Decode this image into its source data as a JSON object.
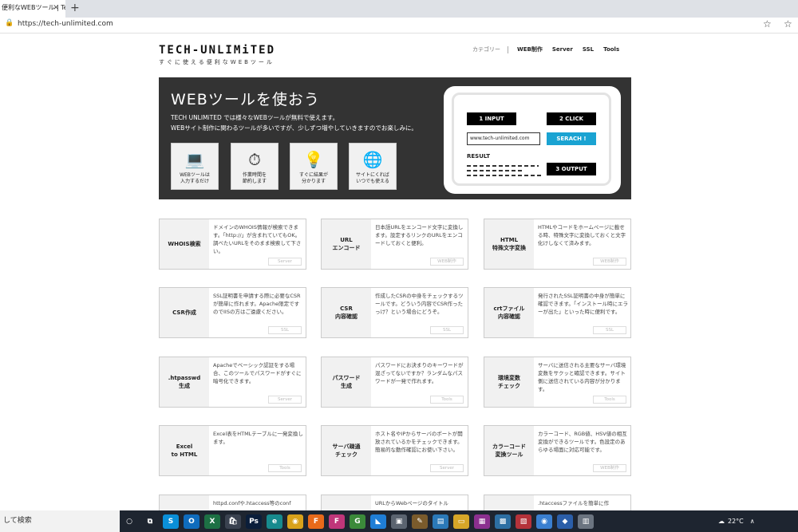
{
  "browser": {
    "tab_title": "便利なWEBツール | Tec",
    "tab_close": "×",
    "new_tab": "+",
    "url": "https://tech-unlimited.com",
    "icons": [
      "lock-icon",
      "favorites-add-icon",
      "favorites-icon"
    ]
  },
  "header": {
    "logo": "TECH-UNLIMiTED",
    "tagline": "すぐに使える便利なWEBツール",
    "nav_category": "カテゴリー",
    "nav": [
      "WEB制作",
      "Server",
      "SSL",
      "Tools"
    ]
  },
  "hero": {
    "title": "WEBツールを使おう",
    "line1": "TECH UNLIMiTED では様々なWEBツールが無料で使えます。",
    "line2": "WEBサイト制作に関わるツールが多いですが、少しずつ増やしていきますのでお楽しみに。",
    "features": [
      {
        "icon": "laptop-icon",
        "glyph": "💻",
        "label": "WEBツールは\n入力するだけ"
      },
      {
        "icon": "clock-money-icon",
        "glyph": "⏱",
        "label": "作業時間を\n節約します"
      },
      {
        "icon": "lightbulb-icon",
        "glyph": "💡",
        "label": "すぐに結果が\n分かります"
      },
      {
        "icon": "globe-icon",
        "glyph": "🌐",
        "label": "サイトにくれば\nいつでも使える"
      }
    ],
    "demo": {
      "input_callout": "1 INPUT",
      "click_callout": "2 CLICK",
      "output_callout": "3 OUTPUT",
      "url_value": "www.tech-unlimited.com",
      "button": "SERACH !",
      "result": "RESULT"
    }
  },
  "cards": [
    {
      "name": "WHOIS検索",
      "desc": "ドメインのWHOIS情報が検索できます。「http://」が含まれていてもOK。調べたいURLをそのまま検索して下さい。",
      "tag": "Server"
    },
    {
      "name": "URL\nエンコード",
      "desc": "日本語URLをエンコード文字に変換します。設定するリンクのURLをエンコードしておくと便利。",
      "tag": "WEB制作"
    },
    {
      "name": "HTML\n特殊文字変換",
      "desc": "HTMLやコードをホームページに載せる時、特殊文字に変換しておくと文字化けしなくて済みます。",
      "tag": "WEB制作"
    },
    {
      "name": "CSR作成",
      "desc": "SSL証明書を申請する際に必要なCSRが簡単に作れます。Apache限定ですのでIISの方はご遠慮ください。",
      "tag": "SSL"
    },
    {
      "name": "CSR\n内容確認",
      "desc": "作成したCSRの中身をチェックするツールです。どういう内容でCSR作ったっけ？という場合にどうぞ。",
      "tag": "SSL"
    },
    {
      "name": "crtファイル\n内容確認",
      "desc": "発行されたSSL証明書の中身が簡単に確認できます。「インストール時にエラーが出た」といった時に便利です。",
      "tag": "SSL"
    },
    {
      "name": ".htpasswd\n生成",
      "desc": "Apacheでベーシック認証をする場合、このツールでパスワードがすぐに暗号化できます。",
      "tag": "Server"
    },
    {
      "name": "パスワード\n生成",
      "desc": "パスワードにお決まりのキーワードが混ざってないですか？ランダムなパスワードが一発で作れます。",
      "tag": "Tools"
    },
    {
      "name": "環境変数\nチェック",
      "desc": "サーバに送信される主要なサーバ環境変数をサクッと確認できます。サイト側に送信されている内容が分かります。",
      "tag": "Tools"
    },
    {
      "name": "Excel\nto HTML",
      "desc": "Excel表をHTMLテーブルに一発変換します。",
      "tag": "Tools"
    },
    {
      "name": "サーバ疎通\nチェック",
      "desc": "ホスト名やIPからサーバのポートが開放されているかをチェックできます。簡易的な動作確認にお使い下さい。",
      "tag": "Server"
    },
    {
      "name": "カラーコード\n変換ツール",
      "desc": "カラーコード、RGB値、HSV値の相互変換ができるツールです。色設定のあらゆる場面に対応可能です。",
      "tag": "WEB制作"
    },
    {
      "name": "",
      "desc": "httpd.confや.htaccess等のconf",
      "tag": ""
    },
    {
      "name": "",
      "desc": "URLからWebページのタイトル",
      "tag": ""
    },
    {
      "name": "",
      "desc": ".htaccessファイルを簡単に作",
      "tag": ""
    }
  ],
  "taskbar": {
    "search": "して検索",
    "apps": [
      {
        "icon": "cortana-icon",
        "glyph": "○",
        "color": "#1e2530"
      },
      {
        "icon": "task-view-icon",
        "glyph": "⧉",
        "color": "#1e2530"
      },
      {
        "icon": "skype-icon",
        "glyph": "S",
        "color": "#0a8fd8"
      },
      {
        "icon": "outlook-icon",
        "glyph": "O",
        "color": "#0f6cbd"
      },
      {
        "icon": "excel-icon",
        "glyph": "X",
        "color": "#1d7044"
      },
      {
        "icon": "store-icon",
        "glyph": "🛍",
        "color": "#3a4250"
      },
      {
        "icon": "photoshop-icon",
        "glyph": "Ps",
        "color": "#0b1e3a"
      },
      {
        "icon": "edge-icon",
        "glyph": "e",
        "color": "#178a8e"
      },
      {
        "icon": "chrome-icon",
        "glyph": "◉",
        "color": "#d9a21b"
      },
      {
        "icon": "firefox-icon",
        "glyph": "F",
        "color": "#e86a1a"
      },
      {
        "icon": "firefox-dev-icon",
        "glyph": "F",
        "color": "#c0367a"
      },
      {
        "icon": "app-icon",
        "glyph": "G",
        "color": "#3b8a3a"
      },
      {
        "icon": "vscode-icon",
        "glyph": "◣",
        "color": "#1f7ed6"
      },
      {
        "icon": "app-icon",
        "glyph": "▣",
        "color": "#5b6470"
      },
      {
        "icon": "app-icon",
        "glyph": "✎",
        "color": "#7a5b2c"
      },
      {
        "icon": "app-icon",
        "glyph": "▤",
        "color": "#2b79b8"
      },
      {
        "icon": "file-explorer-icon",
        "glyph": "▭",
        "color": "#d6a628"
      },
      {
        "icon": "app-icon",
        "glyph": "▦",
        "color": "#8b2f8f"
      },
      {
        "icon": "app-icon",
        "glyph": "▩",
        "color": "#2d6fa3"
      },
      {
        "icon": "app-icon",
        "glyph": "▧",
        "color": "#b5323a"
      },
      {
        "icon": "chrome-icon",
        "glyph": "◉",
        "color": "#3a7fd0"
      },
      {
        "icon": "app-icon",
        "glyph": "◆",
        "color": "#2b5ea8"
      },
      {
        "icon": "app-icon",
        "glyph": "▥",
        "color": "#6b7480"
      }
    ],
    "weather_icon": "weather-icon",
    "weather_glyph": "☁",
    "temp": "22°C",
    "tray_glyph": "∧"
  }
}
